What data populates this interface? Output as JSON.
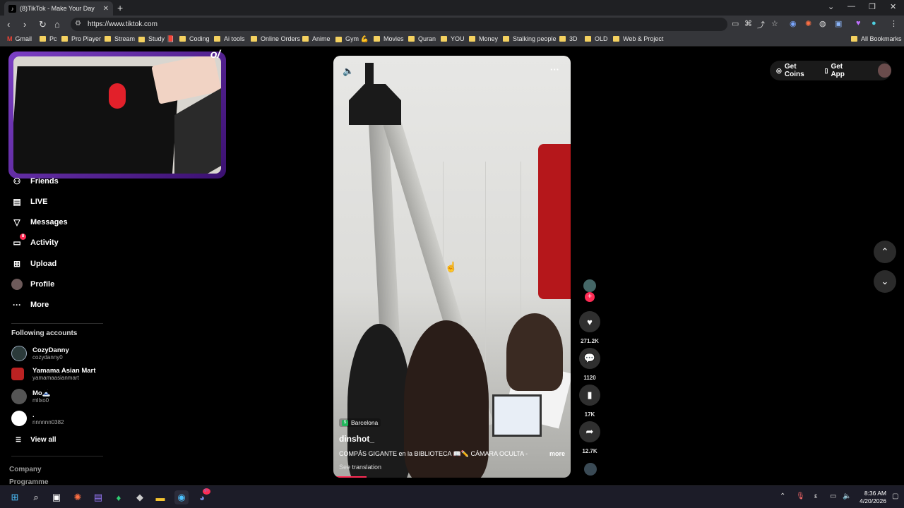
{
  "browser": {
    "tab_title": "(8)TikTok - Make Your Day",
    "url": "https://www.tiktok.com",
    "bookmarks": [
      "Gmail",
      "Pc",
      "Pro Player",
      "Stream",
      "Study 📕",
      "Coding",
      "Ai tools",
      "Online Orders",
      "Anime",
      "Gym 💪",
      "Movies",
      "Quran",
      "YOU",
      "Money",
      "Stalking people",
      "3D",
      "OLD",
      "Web & Project"
    ],
    "all_bookmarks": "All Bookmarks"
  },
  "webcam_logo": "o/",
  "sidebar": {
    "items": [
      {
        "label": "Friends",
        "icon": "friends-icon"
      },
      {
        "label": "LIVE",
        "icon": "live-icon"
      },
      {
        "label": "Messages",
        "icon": "messages-icon"
      },
      {
        "label": "Activity",
        "icon": "activity-icon",
        "badge": "8"
      },
      {
        "label": "Upload",
        "icon": "upload-icon"
      },
      {
        "label": "Profile",
        "icon": "profile-avatar"
      },
      {
        "label": "More",
        "icon": "more-icon"
      }
    ],
    "following_title": "Following accounts",
    "accounts": [
      {
        "name": "CozyDanny",
        "handle": "cozydanny0"
      },
      {
        "name": "Yamama Asian Mart",
        "handle": "yamamaasianmart"
      },
      {
        "name": "Mo🗻",
        "handle": "mllxo0"
      },
      {
        "name": ".",
        "handle": "nnnnnn0382"
      }
    ],
    "view_all": "View all",
    "footer": [
      "Company",
      "Programme"
    ]
  },
  "video": {
    "location": "Barcelona",
    "author": "dinshot_",
    "description": "COMPÁS GIGANTE en la BIBLIOTECA 📖✏️ CÁMARA OCULTA -",
    "more": "more",
    "see_translation": "See translation",
    "progress_fraction": 0.14
  },
  "actions": {
    "likes": "271.2K",
    "comments": "1120",
    "saves": "17K",
    "shares": "12.7K"
  },
  "topbar": {
    "get_coins": "Get Coins",
    "get_app": "Get App"
  },
  "taskbar": {
    "time": "8:36 AM",
    "date": "4/20/2026",
    "discord_badge": "9+"
  }
}
